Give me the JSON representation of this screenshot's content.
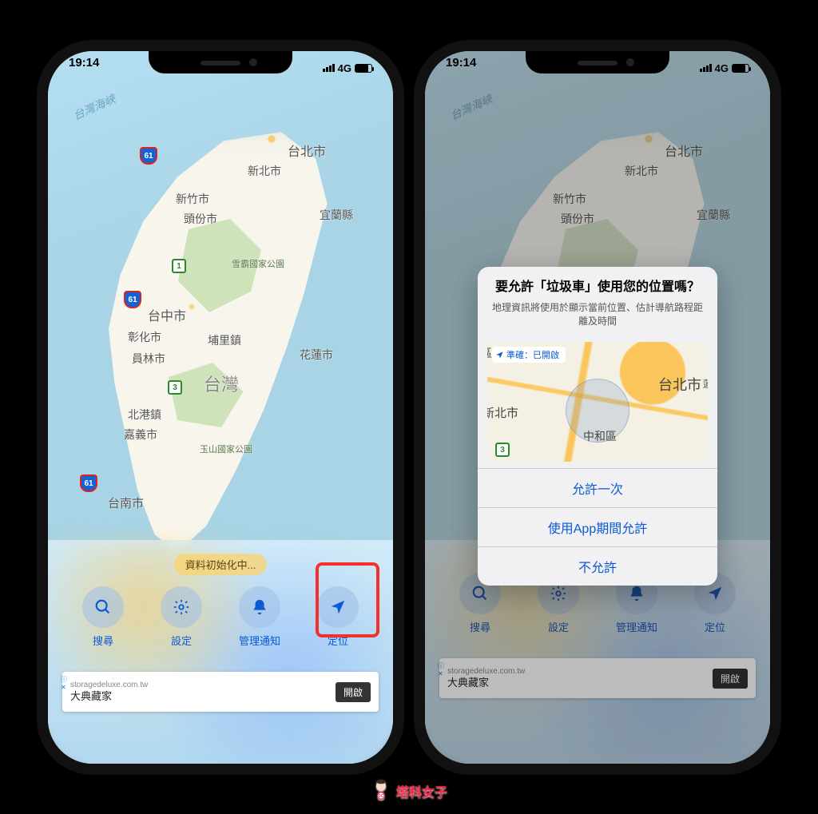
{
  "status": {
    "time": "19:14",
    "network": "4G"
  },
  "map": {
    "strait": "台灣海峽",
    "cities": {
      "taipei": "台北市",
      "newtaipei": "新北市",
      "hsinchu": "新竹市",
      "toufen": "頭份市",
      "yilan": "宜蘭縣",
      "taichung": "台中市",
      "changhua": "彰化市",
      "yuanlin": "員林市",
      "puli": "埔里鎮",
      "hualien": "花蓮市",
      "beigang": "北港鎮",
      "chiayi": "嘉義市",
      "tainan": "台南市",
      "taiwan": "台灣"
    },
    "parks": {
      "xueba": "雪霸國家公園",
      "yushan": "玉山國家公園"
    },
    "shields": {
      "r61": "61",
      "r1": "1",
      "r3": "3"
    }
  },
  "sheet": {
    "init": "資料初始化中...",
    "tabs": {
      "search": "搜尋",
      "settings": "設定",
      "notify": "管理通知",
      "locate": "定位"
    }
  },
  "ad": {
    "url": "storagedeluxe.com.tw",
    "title": "大典藏家",
    "open": "開啟"
  },
  "alert": {
    "title": "要允許「垃圾車」使用您的位置嗎？",
    "subtitle": "地理資訊將使用於顯示當前位置、估計導航路程距離及時間",
    "precision": "準確：已開啟",
    "mini": {
      "taipei": "台北市",
      "newtaipei": "新北市",
      "zhonghe": "中和區",
      "qu": "區",
      "lian": "蓮市"
    },
    "r3": "3",
    "buttons": {
      "once": "允許一次",
      "while": "使用App期間允許",
      "deny": "不允許"
    }
  },
  "watermark": "塔科女子"
}
